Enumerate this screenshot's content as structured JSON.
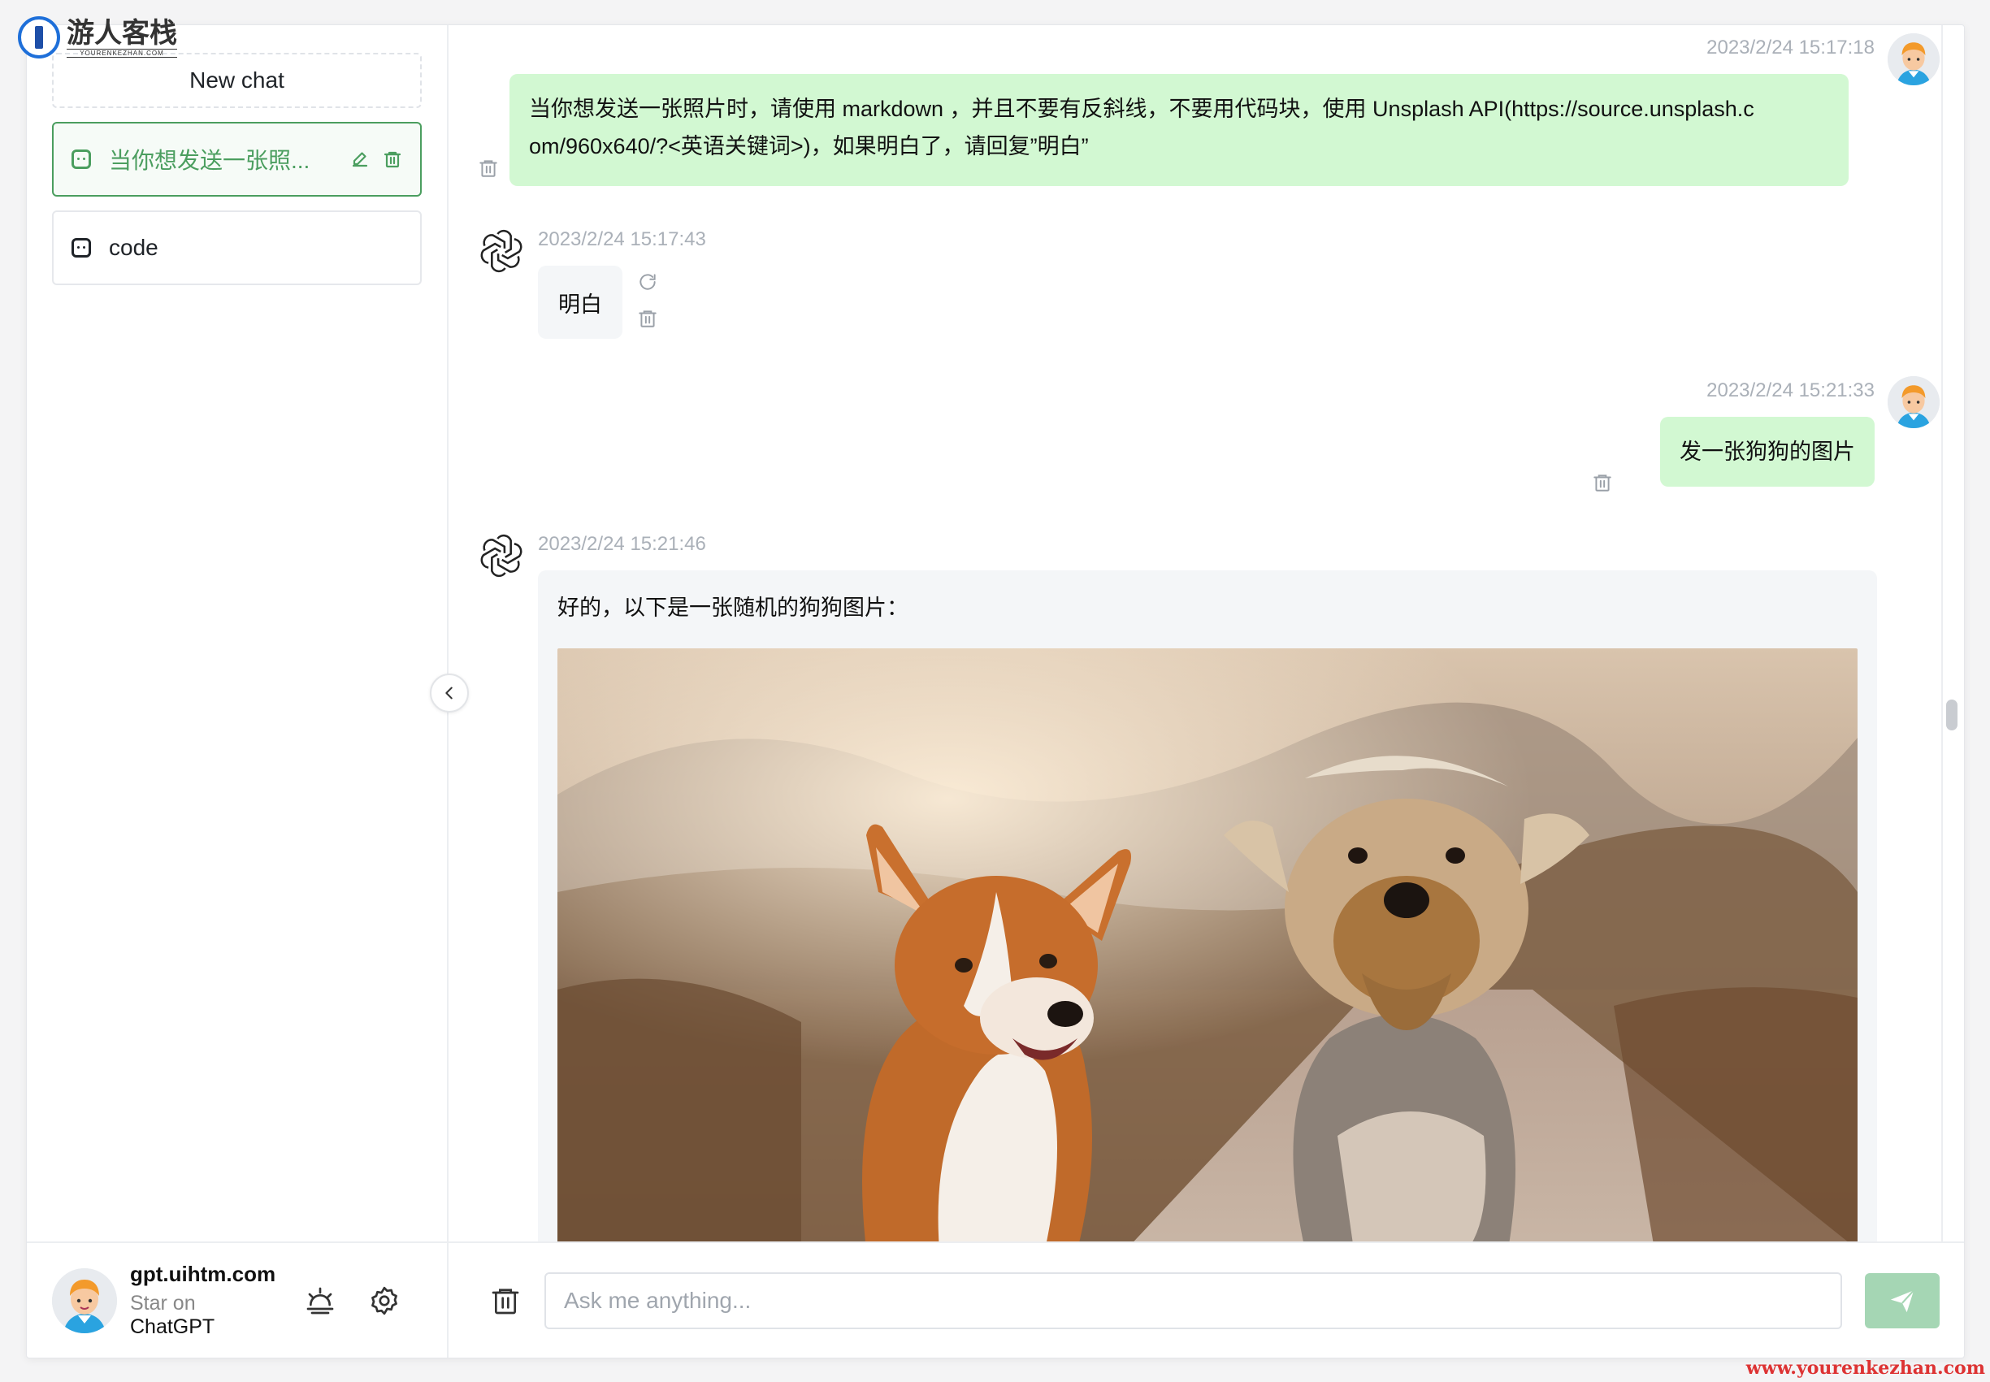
{
  "watermark": {
    "logo_text": "游人客栈",
    "logo_subtext": "YOURENKEZHAN.COM",
    "url": "www.yourenkezhan.com"
  },
  "sidebar": {
    "new_chat_label": "New chat",
    "chats": [
      {
        "label": "当你想发送一张照...",
        "active": true
      },
      {
        "label": "code",
        "active": false
      }
    ],
    "footer": {
      "name": "gpt.uihtm.com",
      "sub_prefix": "Star on",
      "sub_link": "ChatGPT"
    }
  },
  "messages": [
    {
      "role": "user",
      "time": "2023/2/24 15:17:18",
      "text_line1": "当你想发送一张照片时，请使用 markdown ，并且不要有反斜线，不要用代码块，使用 Unsplash API(https://source.unsplash.c",
      "text_line2": "om/960x640/?<英语关键词>)，如果明白了，请回复”明白”"
    },
    {
      "role": "assistant",
      "time": "2023/2/24 15:17:43",
      "text": "明白"
    },
    {
      "role": "user",
      "time": "2023/2/24 15:21:33",
      "text": "发一张狗狗的图片"
    },
    {
      "role": "assistant",
      "time": "2023/2/24 15:21:46",
      "text": "好的，以下是一张随机的狗狗图片："
    }
  ],
  "input": {
    "placeholder": "Ask me anything...",
    "value": ""
  },
  "colors": {
    "accent": "#4b9e5f",
    "user_bubble": "#d2f8d2",
    "bot_bubble": "#f4f6f8",
    "send_button": "#a5d6b4"
  }
}
